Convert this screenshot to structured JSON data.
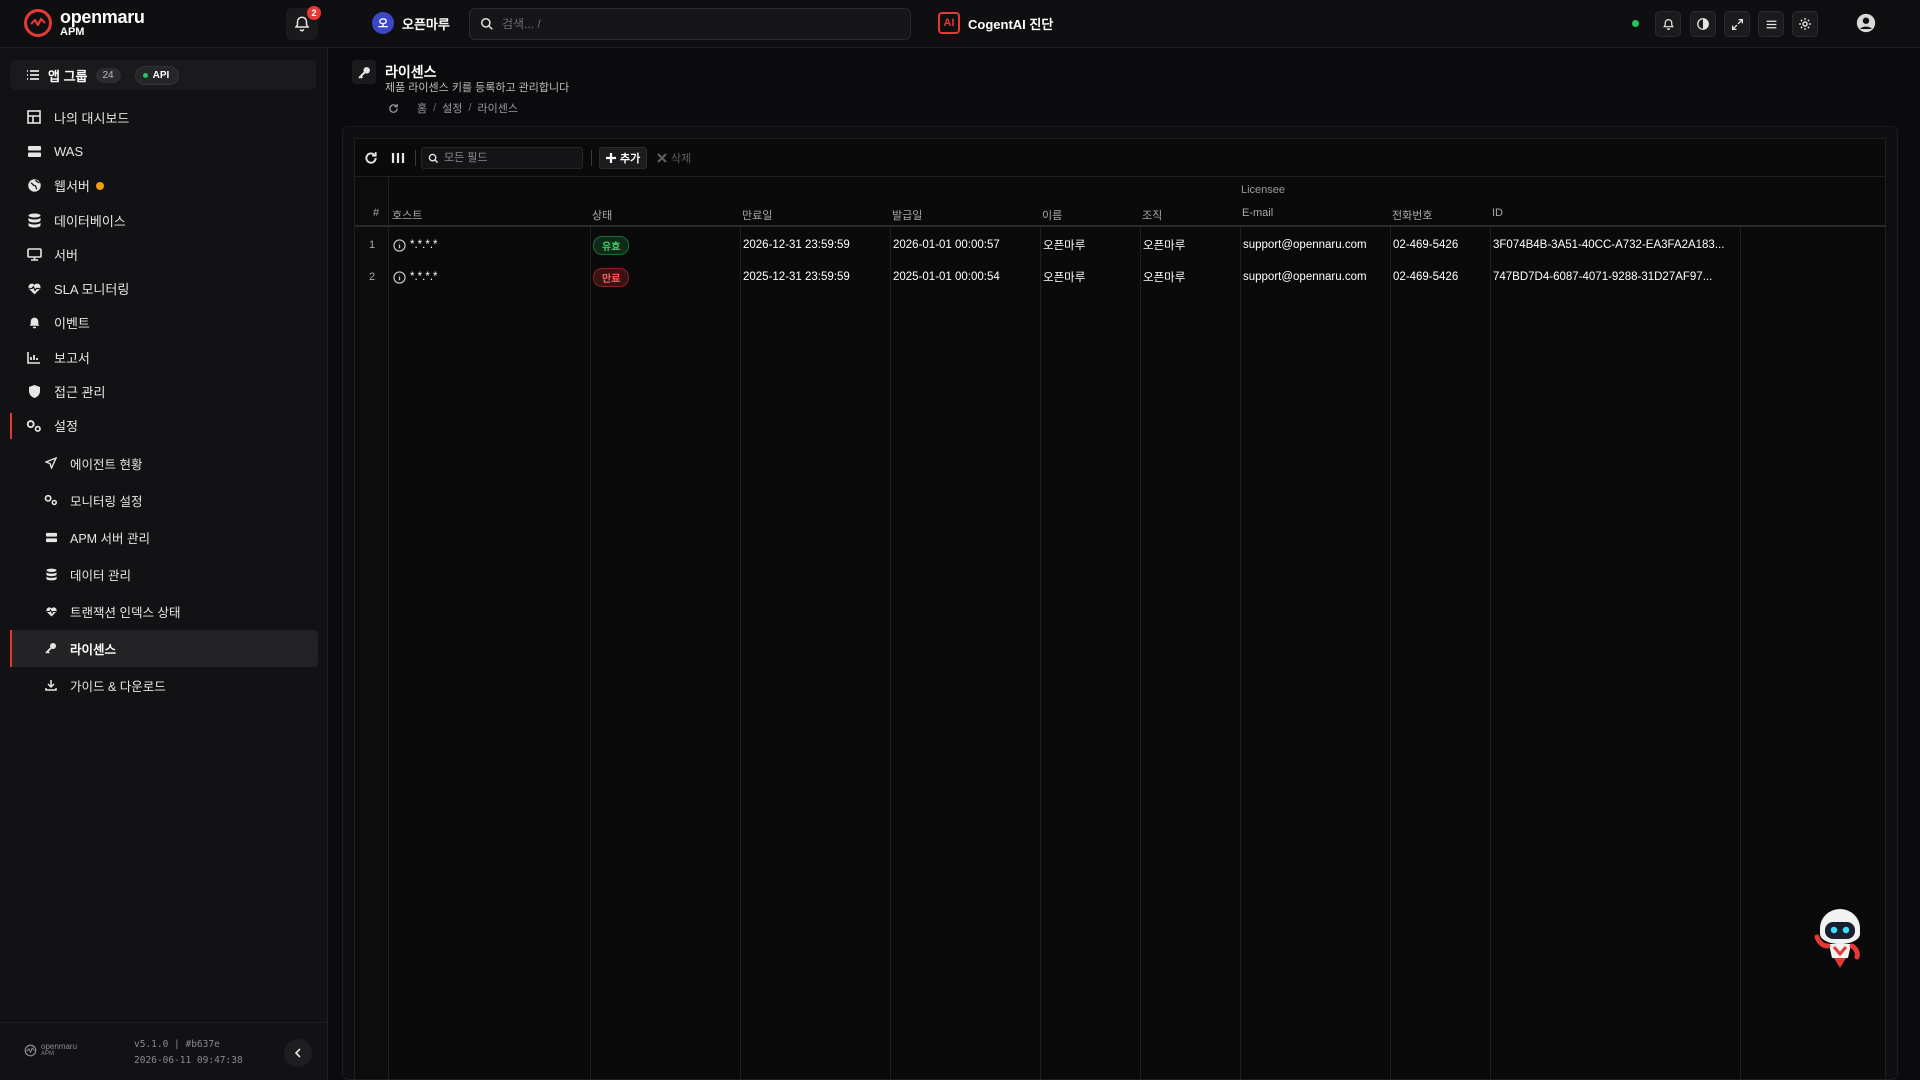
{
  "topbar": {
    "logo_name": "openmaru",
    "logo_sub": "APM",
    "notification_count": "2",
    "org_initial": "오",
    "org_name": "오픈마루",
    "search_placeholder": "검색... /",
    "ai_badge": "AI",
    "ai_label": "CogentAI 진단",
    "status_color": "#22c55e",
    "icons": [
      "bell-icon",
      "contrast-icon",
      "expand-icon",
      "menu-icon",
      "gear-icon",
      "user-icon"
    ]
  },
  "sidebar": {
    "app_group_label": "앱 그룹",
    "app_group_count": "24",
    "api_label": "API",
    "items": [
      {
        "label": "나의 대시보드",
        "icon": "dashboard-icon"
      },
      {
        "label": "WAS",
        "icon": "server-stack-icon"
      },
      {
        "label": "웹서버",
        "icon": "globe-icon",
        "alert": true
      },
      {
        "label": "데이터베이스",
        "icon": "database-icon"
      },
      {
        "label": "서버",
        "icon": "monitor-icon"
      },
      {
        "label": "SLA 모니터링",
        "icon": "heartbeat-icon"
      },
      {
        "label": "이벤트",
        "icon": "bell-icon"
      },
      {
        "label": "보고서",
        "icon": "chart-icon"
      },
      {
        "label": "접근 관리",
        "icon": "shield-icon"
      },
      {
        "label": "설정",
        "icon": "gears-icon"
      }
    ],
    "sub_items": [
      {
        "label": "에이전트 현황",
        "icon": "send-icon"
      },
      {
        "label": "모니터링 설정",
        "icon": "gears-icon"
      },
      {
        "label": "APM 서버 관리",
        "icon": "server-stack-icon"
      },
      {
        "label": "데이터 관리",
        "icon": "database-icon"
      },
      {
        "label": "트랜잭션 인덱스 상태",
        "icon": "heartbeat-icon"
      },
      {
        "label": "라이센스",
        "icon": "key-icon",
        "active": true
      },
      {
        "label": "가이드 & 다운로드",
        "icon": "download-icon"
      }
    ],
    "footer": {
      "logo_name": "openmaru",
      "logo_sub": "APM",
      "version": "v5.1.0 | #b637e",
      "build_time": "2026-06-11 09:47:38"
    }
  },
  "page": {
    "title": "라이센스",
    "subtitle": "제품 라이센스 키를 등록하고 관리합니다",
    "breadcrumb": [
      "홈",
      "설정",
      "라이센스"
    ]
  },
  "toolbar": {
    "filter_placeholder": "모든 필드",
    "add_label": "추가",
    "delete_label": "삭제"
  },
  "table": {
    "group_header": "Licensee",
    "columns": {
      "index": "#",
      "host": "호스트",
      "status": "상태",
      "expires": "만료일",
      "issued": "발급일",
      "name": "이름",
      "org": "조직",
      "email": "E-mail",
      "phone": "전화번호",
      "id": "ID"
    },
    "rows": [
      {
        "index": "1",
        "host": "*.*.*.*",
        "status": "유효",
        "status_type": "valid",
        "expires": "2026-12-31 23:59:59",
        "issued": "2026-01-01 00:00:57",
        "name": "오픈마루",
        "org": "오픈마루",
        "email": "support@opennaru.com",
        "phone": "02-469-5426",
        "id": "3F074B4B-3A51-40CC-A732-EA3FA2A183..."
      },
      {
        "index": "2",
        "host": "*.*.*.*",
        "status": "만료",
        "status_type": "expired",
        "expires": "2025-12-31 23:59:59",
        "issued": "2025-01-01 00:00:54",
        "name": "오픈마루",
        "org": "오픈마루",
        "email": "support@opennaru.com",
        "phone": "02-469-5426",
        "id": "747BD7D4-6087-4071-9288-31D27AF97..."
      }
    ]
  },
  "colors": {
    "accent": "#e53935",
    "valid": "#3fcf6e",
    "expired": "#ff5b5b",
    "alert": "#f59e0b"
  }
}
